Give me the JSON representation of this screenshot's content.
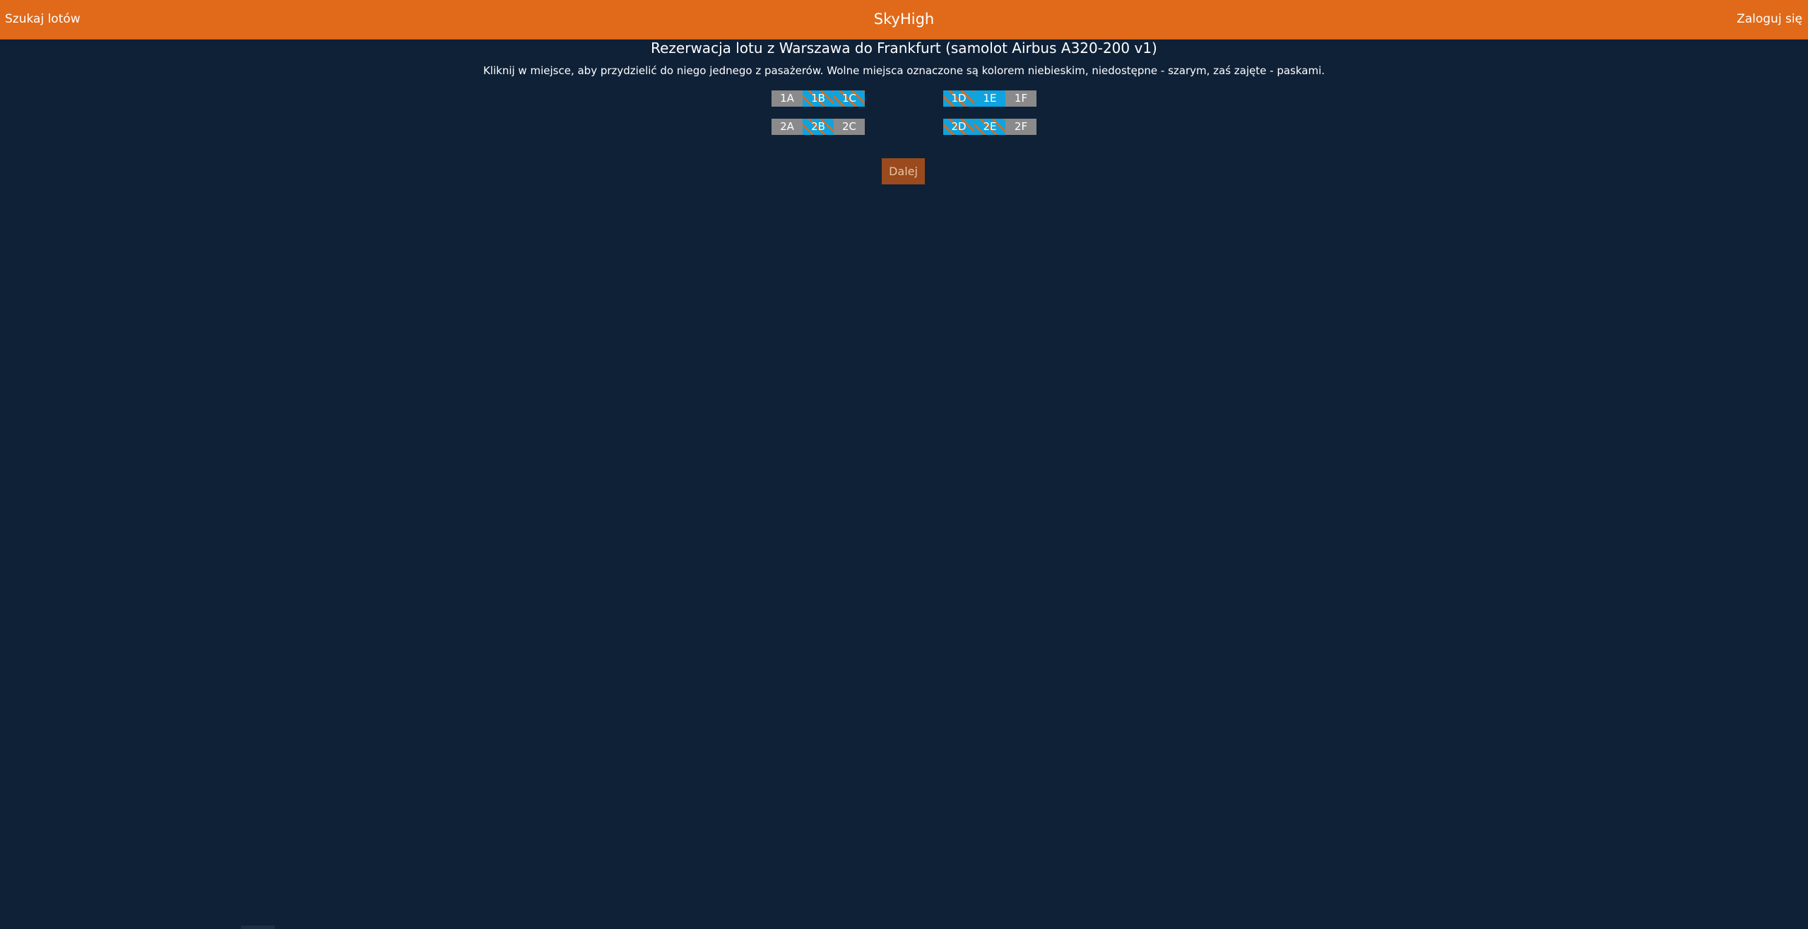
{
  "header": {
    "left_link": "Szukaj lotów",
    "brand": "SkyHigh",
    "right_link": "Zaloguj się"
  },
  "main": {
    "title": "Rezerwacja lotu z Warszawa do Frankfurt (samolot Airbus A320-200 v1)",
    "instructions": "Kliknij w miejsce, aby przydzielić do niego jednego z pasażerów. Wolne miejsca oznaczone są kolorem niebieskim, niedostępne - szarym, zaś zajęte - paskami.",
    "next_button": "Dalej"
  },
  "seats": {
    "row1_left": [
      {
        "label": "1A",
        "state": "unavailable"
      },
      {
        "label": "1B",
        "state": "taken"
      },
      {
        "label": "1C",
        "state": "taken"
      }
    ],
    "row1_right": [
      {
        "label": "1D",
        "state": "taken"
      },
      {
        "label": "1E",
        "state": "free"
      },
      {
        "label": "1F",
        "state": "unavailable"
      }
    ],
    "row2_left": [
      {
        "label": "2A",
        "state": "unavailable"
      },
      {
        "label": "2B",
        "state": "taken"
      },
      {
        "label": "2C",
        "state": "unavailable"
      }
    ],
    "row2_right": [
      {
        "label": "2D",
        "state": "taken"
      },
      {
        "label": "2E",
        "state": "taken"
      },
      {
        "label": "2F",
        "state": "unavailable"
      }
    ]
  },
  "colors": {
    "header_bg": "#e06a1a",
    "page_bg": "#0f2137",
    "seat_free": "#0fa3df",
    "seat_unavailable": "#8a8a8a",
    "seat_taken_stripe": "#d96a1d",
    "button_bg": "#9a4a1d"
  }
}
